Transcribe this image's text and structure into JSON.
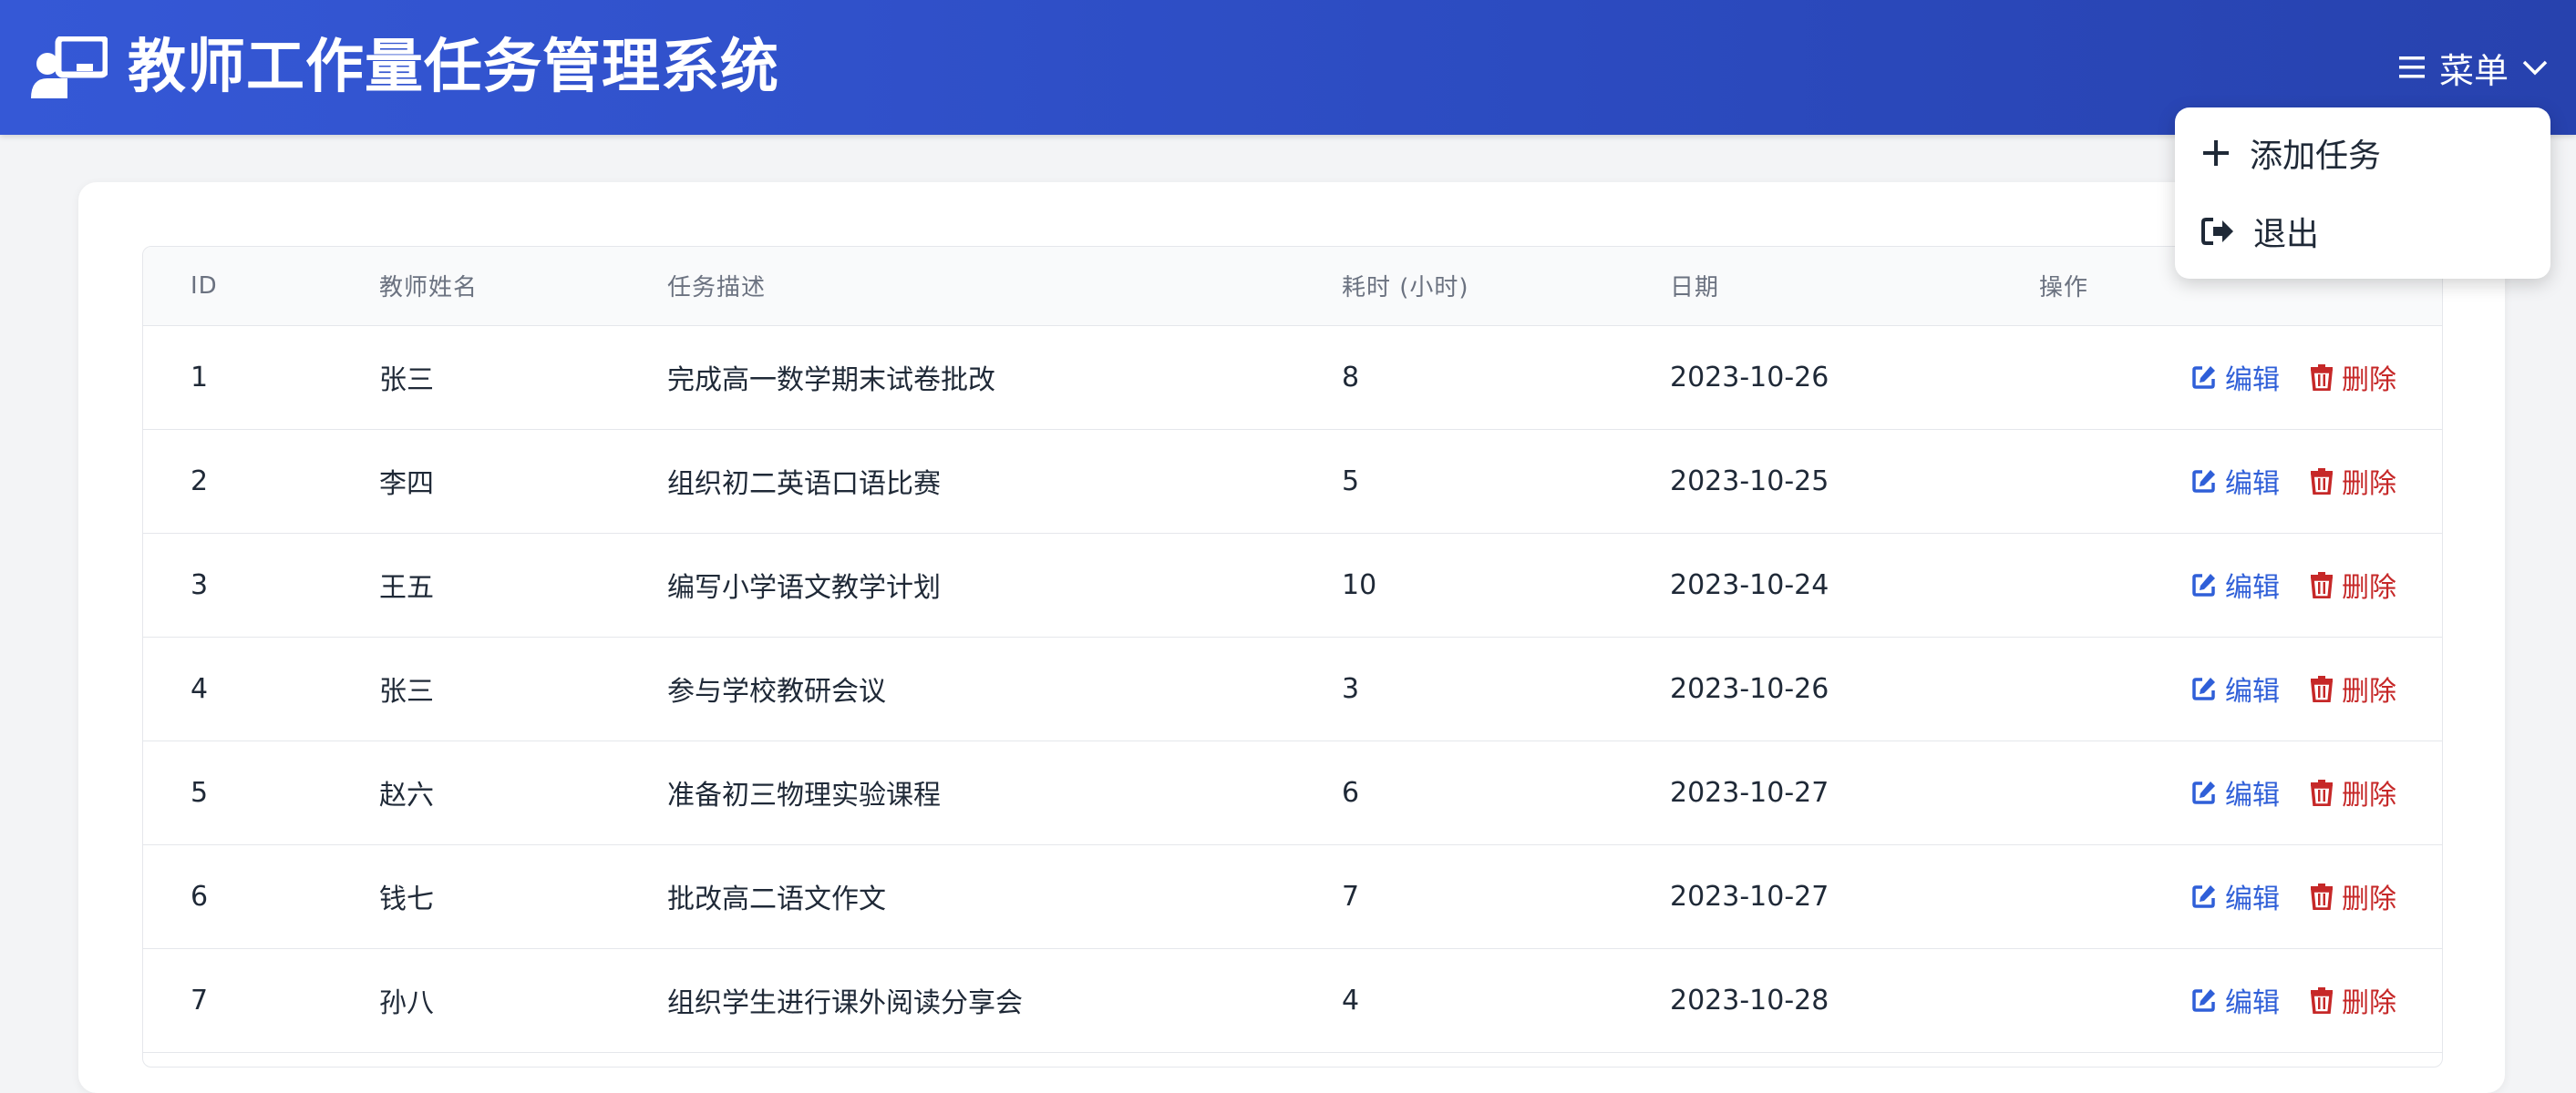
{
  "header": {
    "title": "教师工作量任务管理系统",
    "menu_label": "菜单",
    "logo_icon": "chalkboard-teacher-icon"
  },
  "dropdown": {
    "items": [
      {
        "label": "添加任务",
        "icon": "plus-icon"
      },
      {
        "label": "退出",
        "icon": "sign-out-icon"
      }
    ]
  },
  "table": {
    "columns": [
      "ID",
      "教师姓名",
      "任务描述",
      "耗时 (小时)",
      "日期",
      "操作"
    ],
    "rows": [
      {
        "id": "1",
        "name": "张三",
        "desc": "完成高一数学期末试卷批改",
        "hours": "8",
        "date": "2023-10-26"
      },
      {
        "id": "2",
        "name": "李四",
        "desc": "组织初二英语口语比赛",
        "hours": "5",
        "date": "2023-10-25"
      },
      {
        "id": "3",
        "name": "王五",
        "desc": "编写小学语文教学计划",
        "hours": "10",
        "date": "2023-10-24"
      },
      {
        "id": "4",
        "name": "张三",
        "desc": "参与学校教研会议",
        "hours": "3",
        "date": "2023-10-26"
      },
      {
        "id": "5",
        "name": "赵六",
        "desc": "准备初三物理实验课程",
        "hours": "6",
        "date": "2023-10-27"
      },
      {
        "id": "6",
        "name": "钱七",
        "desc": "批改高二语文作文",
        "hours": "7",
        "date": "2023-10-27"
      },
      {
        "id": "7",
        "name": "孙八",
        "desc": "组织学生进行课外阅读分享会",
        "hours": "4",
        "date": "2023-10-28"
      }
    ],
    "edit_label": "编辑",
    "delete_label": "删除"
  },
  "colors": {
    "header_bg": "#3558d6",
    "edit": "#2f5fd8",
    "delete": "#c62828"
  }
}
